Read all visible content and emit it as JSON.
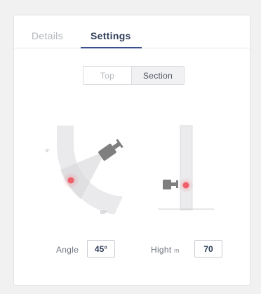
{
  "tabs": [
    {
      "label": "Details",
      "active": false
    },
    {
      "label": "Settings",
      "active": true
    }
  ],
  "view_toggle": {
    "options": [
      "Top",
      "Section"
    ],
    "selected": "Section"
  },
  "angle_scale": {
    "start_label": "0°",
    "end_label": "90°"
  },
  "fields": {
    "angle": {
      "label": "Angle",
      "value": "45°"
    },
    "height": {
      "label": "Hight",
      "unit": "m",
      "value": "70"
    }
  },
  "colors": {
    "accent": "#3b4f8a",
    "marker": "#f0606a",
    "camera": "#8a8a8a"
  },
  "icons": [
    "camera-icon",
    "marker-icon"
  ]
}
